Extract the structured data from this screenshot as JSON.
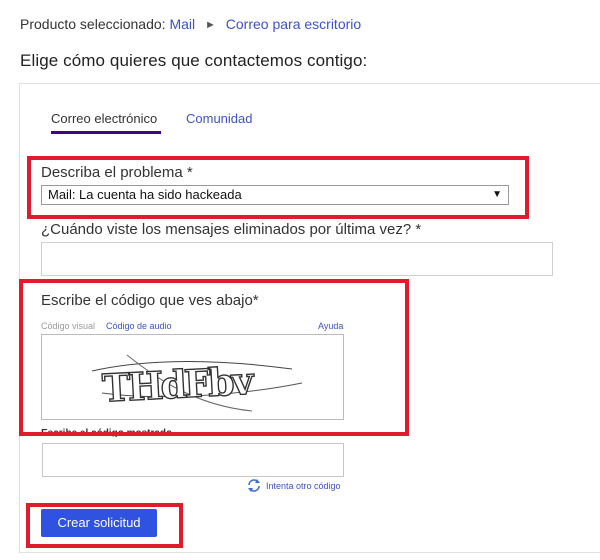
{
  "breadcrumb": {
    "prefix": "Producto seleccionado:",
    "product": "Mail",
    "separator": "►",
    "subproduct": "Correo para escritorio"
  },
  "page_title": "Elige cómo quieres que contactemos contigo:",
  "tabs": [
    {
      "label": "Correo electrónico",
      "active": true
    },
    {
      "label": "Comunidad",
      "active": false
    }
  ],
  "form": {
    "problem_label": "Describa el problema *",
    "problem_value": "Mail: La cuenta ha sido hackeada",
    "date_label": "¿Cuándo viste los mensajes eliminados por última vez? *",
    "date_value": "",
    "captcha": {
      "heading": "Escribe el código que ves abajo*",
      "visual_label": "Código visual",
      "audio_label": "Código de audio",
      "help_label": "Ayuda",
      "image_text": "THdFbv",
      "input_label": "Escribe el código mostrado",
      "input_value": "",
      "refresh_label": "Intenta otro código"
    },
    "submit_label": "Crear solicitud"
  },
  "colors": {
    "link": "#3b53c6",
    "tab_underline": "#400090",
    "highlight_border": "#e01b2b",
    "submit_bg": "#2f52e0"
  }
}
